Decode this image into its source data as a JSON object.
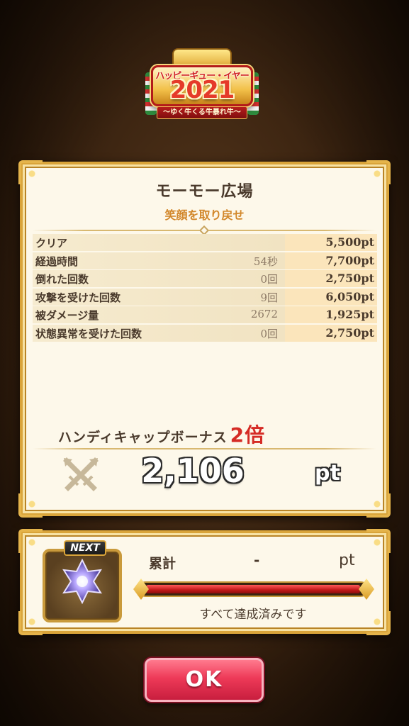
{
  "event_logo": {
    "tagline": "ハッピーギュー・イヤー",
    "year": "2021",
    "ribbon": "〜ゆく牛くる牛暴れ牛〜"
  },
  "result": {
    "stage_title": "モーモー広場",
    "quest_title": "笑顔を取り戻せ",
    "rows": [
      {
        "label": "クリア",
        "value": "",
        "points": "5,500pt"
      },
      {
        "label": "経過時間",
        "value": "54秒",
        "points": "7,700pt"
      },
      {
        "label": "倒れた回数",
        "value": "0回",
        "points": "2,750pt"
      },
      {
        "label": "攻撃を受けた回数",
        "value": "9回",
        "points": "6,050pt"
      },
      {
        "label": "被ダメージ量",
        "value": "2672",
        "points": "1,925pt"
      },
      {
        "label": "状態異常を受けた回数",
        "value": "0回",
        "points": "2,750pt"
      }
    ],
    "bonus_label": "ハンディキャップボーナス",
    "bonus_multiplier": "2倍",
    "total": "2,106",
    "total_unit": "pt",
    "icon": "crossed-swords-icon"
  },
  "next_reward": {
    "badge": "NEXT",
    "icon": "star-gem-icon",
    "cumulative_label": "累計",
    "cumulative_value": "-",
    "cumulative_unit": "pt",
    "progress": 1.0,
    "status": "すべて達成済みです"
  },
  "ok_button": {
    "label": "OK"
  },
  "colors": {
    "panel_bg": "#fdf8ea",
    "gold_border": "#d9a43a",
    "accent_orange": "#d2872a",
    "bonus_red": "#d52b25",
    "ok_pink": "#ee3a58",
    "progress_red": "#c01818"
  }
}
